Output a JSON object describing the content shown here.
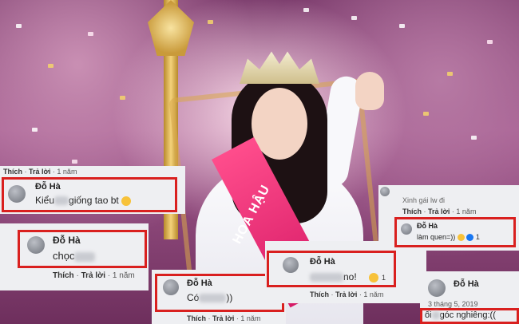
{
  "overlay": {
    "sash_text": "HOA HẬU"
  },
  "comments": {
    "c1": {
      "actions": {
        "like": "Thích",
        "reply": "Trả lời",
        "time": "1 năm"
      },
      "name": "Đỗ Hà",
      "text_prefix": "Kiểu",
      "text_suffix": "giống tao bt",
      "emoji": "money-face-emoji"
    },
    "c2": {
      "name": "Đỗ Hà",
      "text_prefix": "chọc",
      "actions": {
        "like": "Thích",
        "reply": "Trả lời",
        "time": "1 năm"
      }
    },
    "c3": {
      "name": "Đỗ Hà",
      "text_prefix": "Có",
      "text_suffix": "))",
      "actions": {
        "like": "Thích",
        "reply": "Trả lời",
        "time": "1 năm"
      }
    },
    "c4": {
      "name": "Đỗ Hà",
      "text_suffix": "no!",
      "reaction_count": "1",
      "actions": {
        "like": "Thích",
        "reply": "Trả lời",
        "time": "1 năm"
      }
    },
    "c5": {
      "above_text": "Xinh gái lw đi",
      "actions": {
        "like": "Thích",
        "reply": "Trả lời",
        "time": "1 năm"
      },
      "name": "Đỗ Hà",
      "text": "làm quen=))",
      "reaction_count": "1"
    },
    "c6": {
      "name": "Đỗ Hà",
      "date": "3 tháng 5, 2019",
      "text_prefix": "ối",
      "text_suffix": "góc nghiêng:(("
    }
  },
  "colors": {
    "highlight": "#d9201f",
    "panel": "#eeeff2",
    "sash": "#e52c77"
  }
}
